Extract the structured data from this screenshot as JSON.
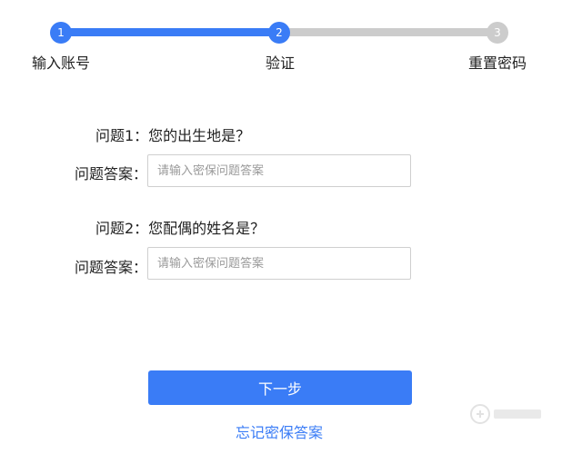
{
  "colors": {
    "accent": "#3a7cf6",
    "inactive": "#cccccc",
    "text": "#222222",
    "input_border": "#cfcfcf",
    "placeholder": "#9a9a9a"
  },
  "stepper": {
    "current_step": 2,
    "steps": [
      {
        "number": "1",
        "label": "输入账号"
      },
      {
        "number": "2",
        "label": "验证"
      },
      {
        "number": "3",
        "label": "重置密码"
      }
    ]
  },
  "form": {
    "questions": [
      {
        "question": "问题1：您的出生地是？",
        "answer_label": "问题答案：",
        "answer_value": "",
        "answer_placeholder": "请输入密保问题答案"
      },
      {
        "question": "问题2：您配偶的姓名是？",
        "answer_label": "问题答案：",
        "answer_value": "",
        "answer_placeholder": "请输入密保问题答案"
      }
    ]
  },
  "actions": {
    "next_label": "下一步",
    "forgot_label": "忘记密保答案"
  },
  "watermark": {
    "icon": "watermark-logo-icon"
  }
}
